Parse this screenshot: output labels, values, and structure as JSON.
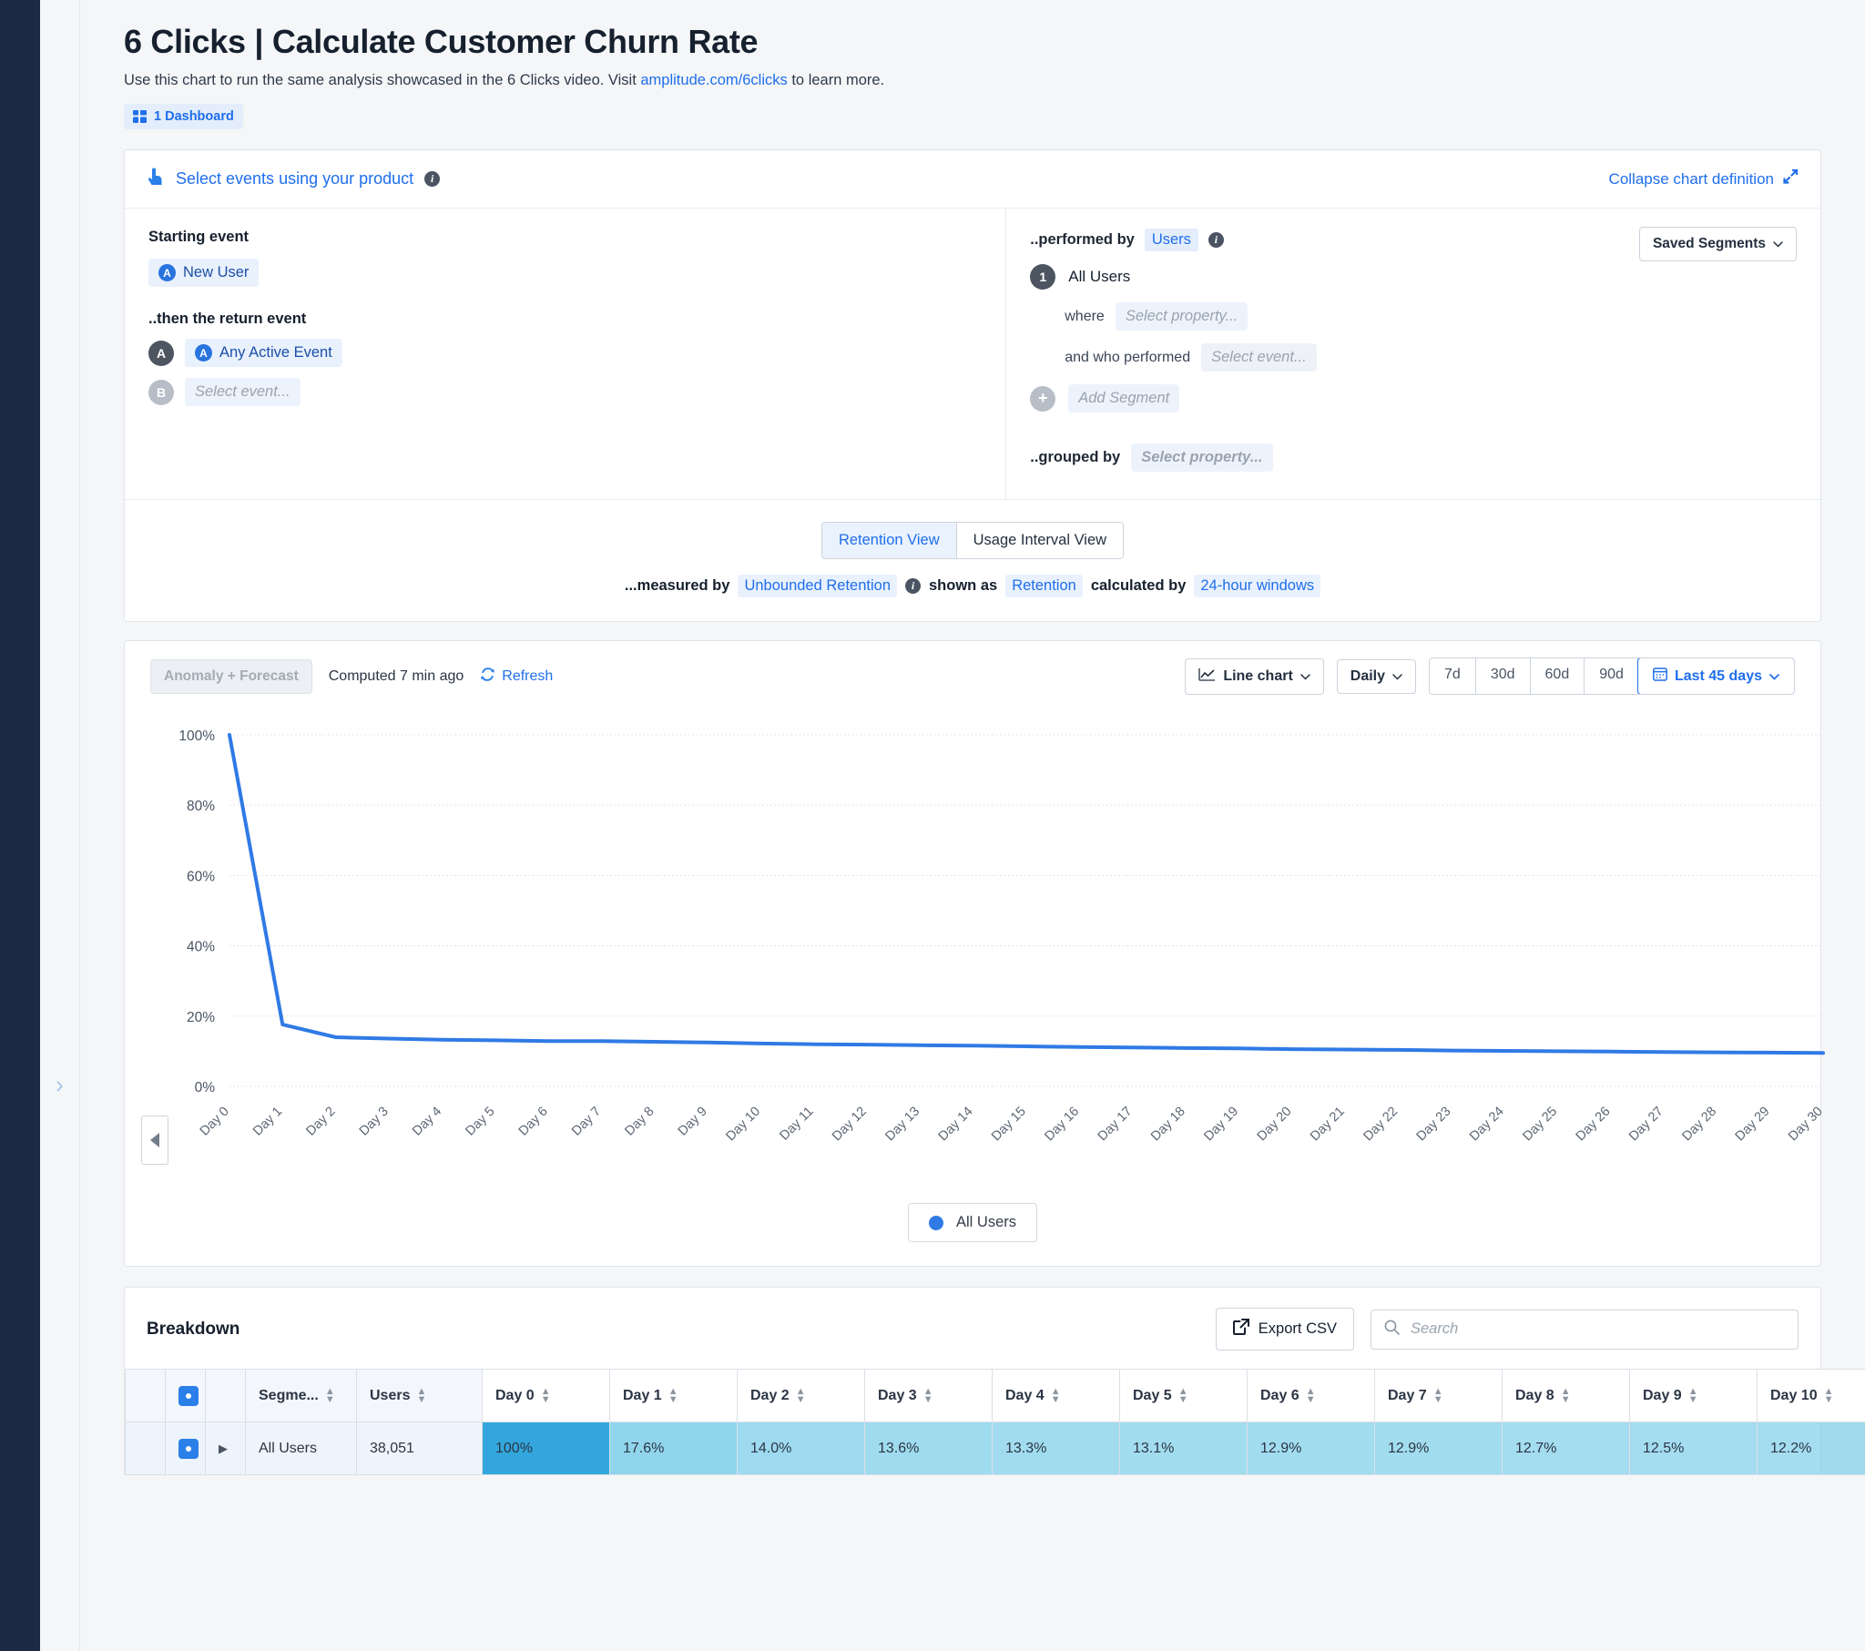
{
  "header": {
    "title": "6 Clicks | Calculate Customer Churn Rate",
    "subtitle_before": "Use this chart to run the same analysis showcased in the 6 Clicks video. Visit ",
    "subtitle_link": "amplitude.com/6clicks",
    "subtitle_after": " to learn more.",
    "dashboard_badge": "1 Dashboard",
    "dashboard_icon": "dashboard-icon"
  },
  "definition": {
    "select_events_label": "Select events using your product",
    "select_events_icon": "pointer-tap-icon",
    "info_icon": "info-icon",
    "collapse_label": "Collapse chart definition",
    "collapse_icon": "collapse-arrows-icon",
    "left": {
      "starting_event_label": "Starting event",
      "starting_event_chip": "New User",
      "starting_event_icon": "amplitude-event-icon",
      "return_event_label": "..then the return event",
      "rows": [
        {
          "badge": "A",
          "chip": "Any Active Event",
          "icon": "amplitude-event-icon",
          "placeholder": false
        },
        {
          "badge": "B",
          "chip": "Select event...",
          "icon": "",
          "placeholder": true
        }
      ]
    },
    "right": {
      "performed_by_label": "..performed by",
      "performed_by_value": "Users",
      "saved_segments_label": "Saved Segments",
      "saved_segments_icon": "chevron-down-icon",
      "segment_index": "1",
      "segment_name": "All Users",
      "where_label": "where",
      "where_placeholder": "Select property...",
      "and_who_label": "and who performed",
      "and_who_placeholder": "Select event...",
      "add_segment_label": "Add Segment",
      "add_segment_icon": "plus-icon",
      "grouped_by_label": "..grouped by",
      "grouped_by_placeholder": "Select property..."
    },
    "view_tabs": [
      {
        "label": "Retention View",
        "active": true
      },
      {
        "label": "Usage Interval View",
        "active": false
      }
    ],
    "measure": {
      "measured_by_label": "...measured by",
      "measured_by_value": "Unbounded Retention",
      "shown_as_label": "shown as",
      "shown_as_value": "Retention",
      "calculated_by_label": "calculated by",
      "calculated_by_value": "24-hour windows"
    }
  },
  "chart_toolbar": {
    "anomaly_label": "Anomaly + Forecast",
    "computed_label": "Computed 7 min ago",
    "refresh_label": "Refresh",
    "refresh_icon": "refresh-icon",
    "chart_type": "Line chart",
    "chart_type_icon": "line-chart-icon",
    "interval": "Daily",
    "ranges": [
      "7d",
      "30d",
      "60d",
      "90d"
    ],
    "selected_range": "Last 45 days",
    "calendar_icon": "calendar-icon"
  },
  "chart_data": {
    "type": "line",
    "title": "",
    "xlabel": "",
    "ylabel": "",
    "ylim": [
      0,
      100
    ],
    "yticks": [
      "0%",
      "20%",
      "40%",
      "60%",
      "80%",
      "100%"
    ],
    "ytick_values": [
      0,
      20,
      40,
      60,
      80,
      100
    ],
    "grid": true,
    "legend_position": "bottom",
    "categories": [
      "Day 0",
      "Day 1",
      "Day 2",
      "Day 3",
      "Day 4",
      "Day 5",
      "Day 6",
      "Day 7",
      "Day 8",
      "Day 9",
      "Day 10",
      "Day 11",
      "Day 12",
      "Day 13",
      "Day 14",
      "Day 15",
      "Day 16",
      "Day 17",
      "Day 18",
      "Day 19",
      "Day 20",
      "Day 21",
      "Day 22",
      "Day 23",
      "Day 24",
      "Day 25",
      "Day 26",
      "Day 27",
      "Day 28",
      "Day 29",
      "Day 30"
    ],
    "series": [
      {
        "name": "All Users",
        "color": "#2f7ae5",
        "values": [
          100,
          17.6,
          14.0,
          13.6,
          13.3,
          13.1,
          12.9,
          12.9,
          12.7,
          12.5,
          12.2,
          12.0,
          11.9,
          11.7,
          11.6,
          11.4,
          11.2,
          11.1,
          10.9,
          10.8,
          10.6,
          10.5,
          10.4,
          10.2,
          10.1,
          10.0,
          9.9,
          9.8,
          9.7,
          9.6,
          9.5
        ]
      }
    ],
    "legend": [
      {
        "label": "All Users",
        "color": "#2f7ae5"
      }
    ]
  },
  "breakdown": {
    "title": "Breakdown",
    "export_label": "Export CSV",
    "export_icon": "export-icon",
    "search_placeholder": "Search",
    "search_value": "",
    "search_icon": "search-icon",
    "columns": [
      "Segme...",
      "Users",
      "Day 0",
      "Day 1",
      "Day 2",
      "Day 3",
      "Day 4",
      "Day 5",
      "Day 6",
      "Day 7",
      "Day 8",
      "Day 9",
      "Day 10"
    ],
    "rows": [
      {
        "segment": "All Users",
        "users": "38,051",
        "values": [
          "100%",
          "17.6%",
          "14.0%",
          "13.6%",
          "13.3%",
          "13.1%",
          "12.9%",
          "12.9%",
          "12.7%",
          "12.5%",
          "12.2%"
        ]
      }
    ]
  },
  "colors": {
    "accent": "#1f6feb",
    "line": "#2f7ae5",
    "heat_strong": "#33a7dd",
    "heat_light": "#bfe4f2",
    "nav_rail": "#1c2a43"
  }
}
